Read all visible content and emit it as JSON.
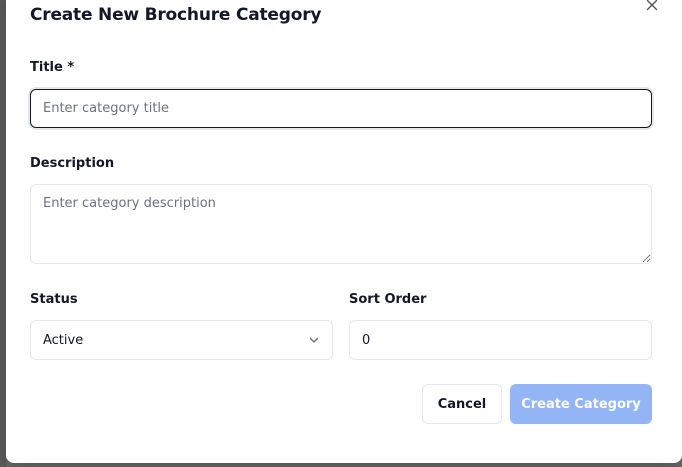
{
  "dialog": {
    "title": "Create New Brochure Category",
    "close_icon": "close-icon"
  },
  "form": {
    "title_label": "Title *",
    "title_placeholder": "Enter category title",
    "title_value": "",
    "description_label": "Description",
    "description_placeholder": "Enter category description",
    "description_value": "",
    "status_label": "Status",
    "status_selected": "Active",
    "sort_order_label": "Sort Order",
    "sort_order_value": "0"
  },
  "actions": {
    "cancel_label": "Cancel",
    "create_label": "Create Category"
  },
  "colors": {
    "primary_disabled": "#93b4f5",
    "text": "#111827",
    "placeholder": "#6b7280",
    "border": "#e5e7eb"
  }
}
